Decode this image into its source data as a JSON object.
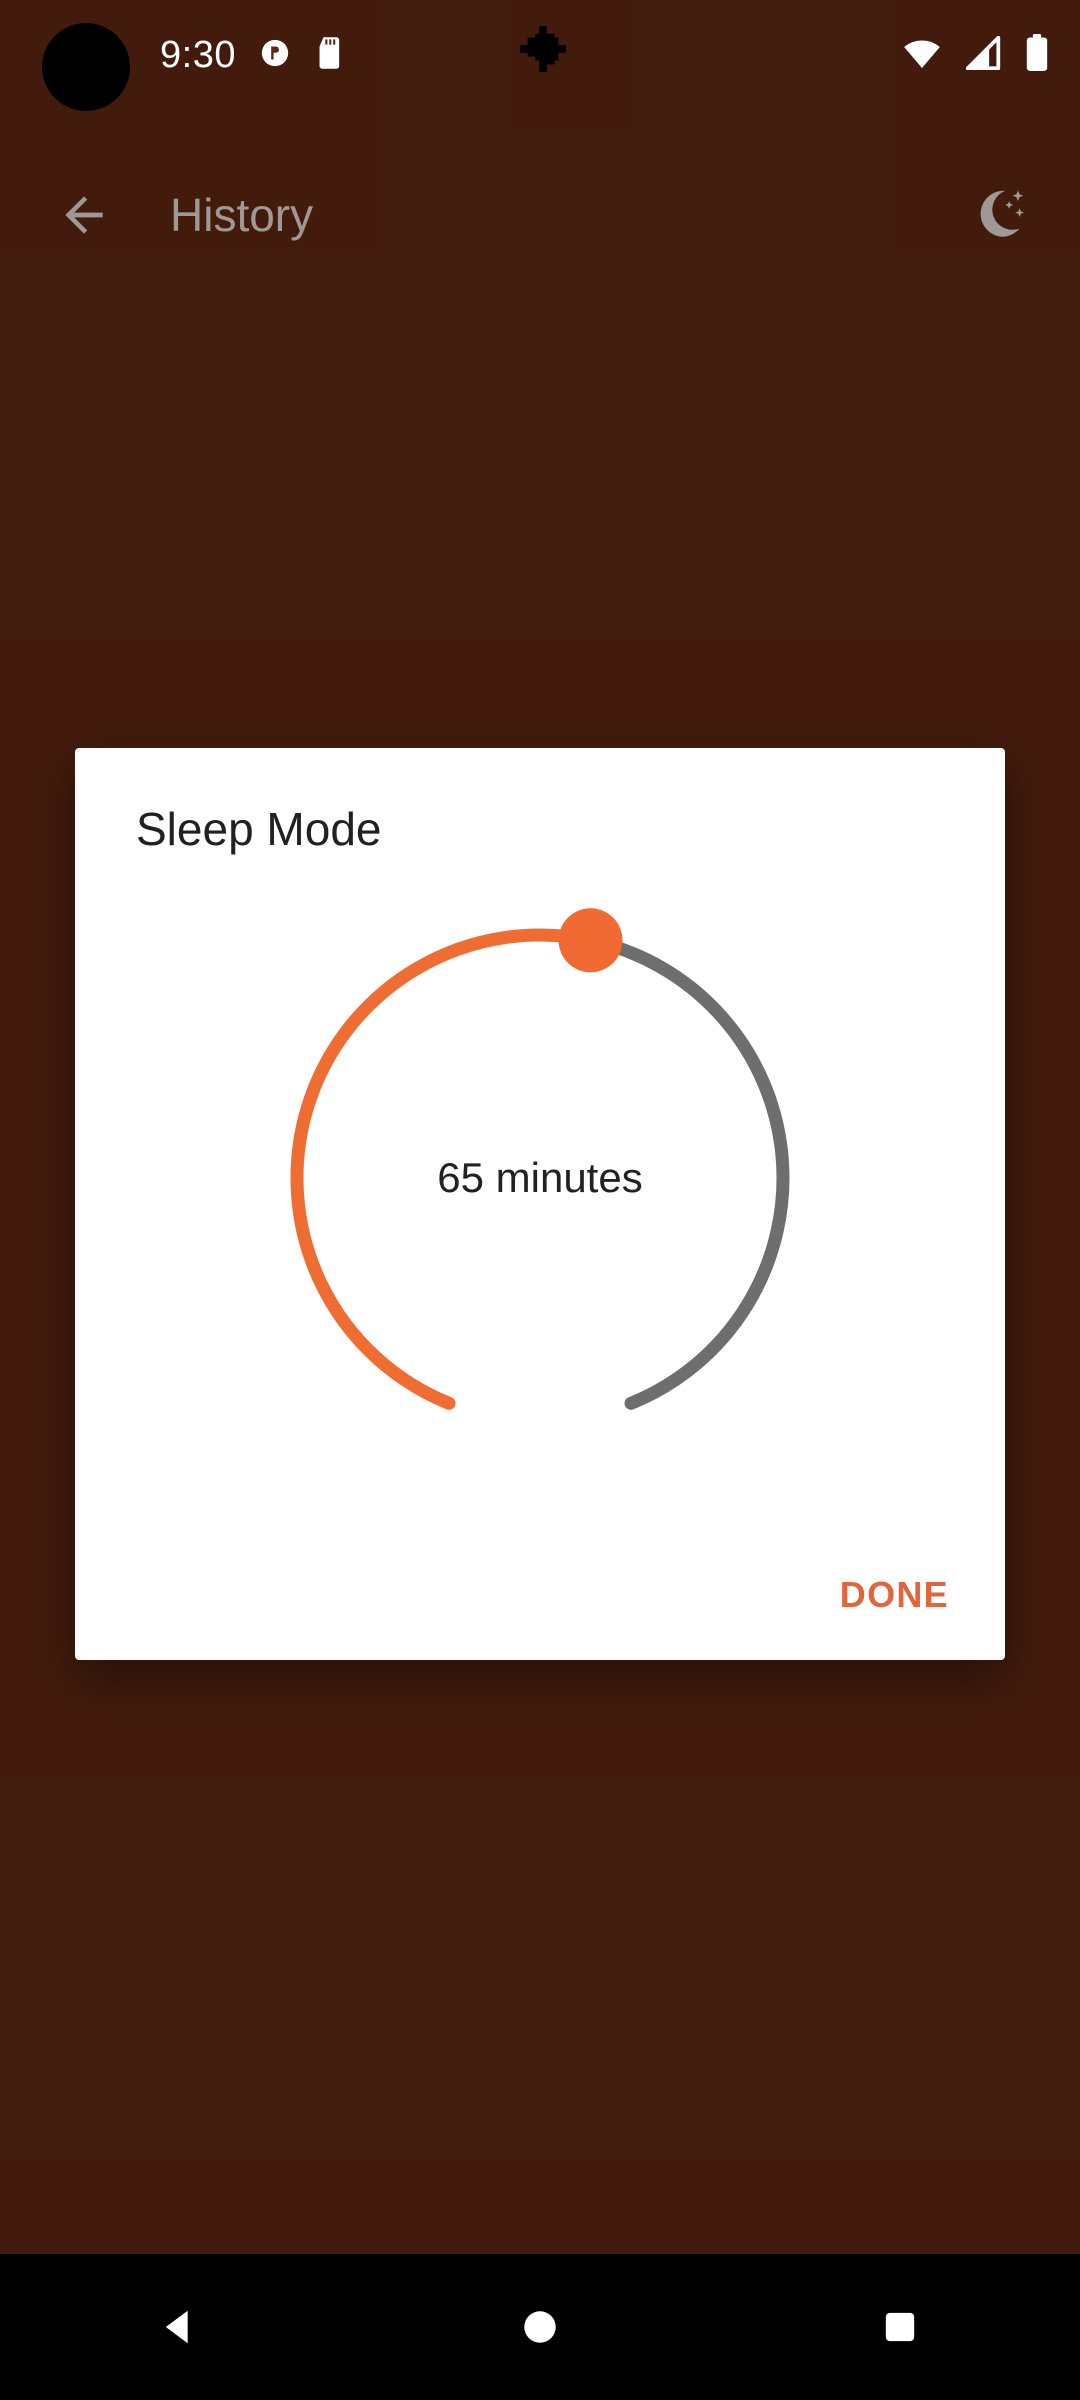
{
  "status_bar": {
    "clock": "9:30",
    "left_icons": [
      {
        "name": "do-not-disturb-icon"
      },
      {
        "name": "sd-card-icon"
      }
    ],
    "right_icons": [
      {
        "name": "wifi-icon"
      },
      {
        "name": "cellular-signal-icon"
      },
      {
        "name": "battery-icon"
      }
    ],
    "camera_punch_hole": "camera-punch-hole"
  },
  "app_bar": {
    "back_label": "Back",
    "title": "History",
    "night_mode_icon": "moon-stars-icon"
  },
  "dialog": {
    "title": "Sleep Mode",
    "value_label": "65 minutes",
    "minutes": 65,
    "done_label": "DONE",
    "slider": {
      "type": "circular-slider",
      "progress_arc_color": "#EF6C33",
      "track_arc_color": "#6E6E6E",
      "thumb_color": "#F06A32",
      "value": 65,
      "gap_bottom_degrees": 44
    }
  },
  "nav_bar": {
    "back_icon": "nav-back-triangle-icon",
    "home_icon": "nav-home-circle-icon",
    "recents_icon": "nav-recents-square-icon"
  },
  "colors": {
    "background": "#5C2A17",
    "accent": "#EF6C33",
    "surface": "#FFFFFF",
    "done_text": "#E2653C",
    "nav_bar": "#000000"
  }
}
